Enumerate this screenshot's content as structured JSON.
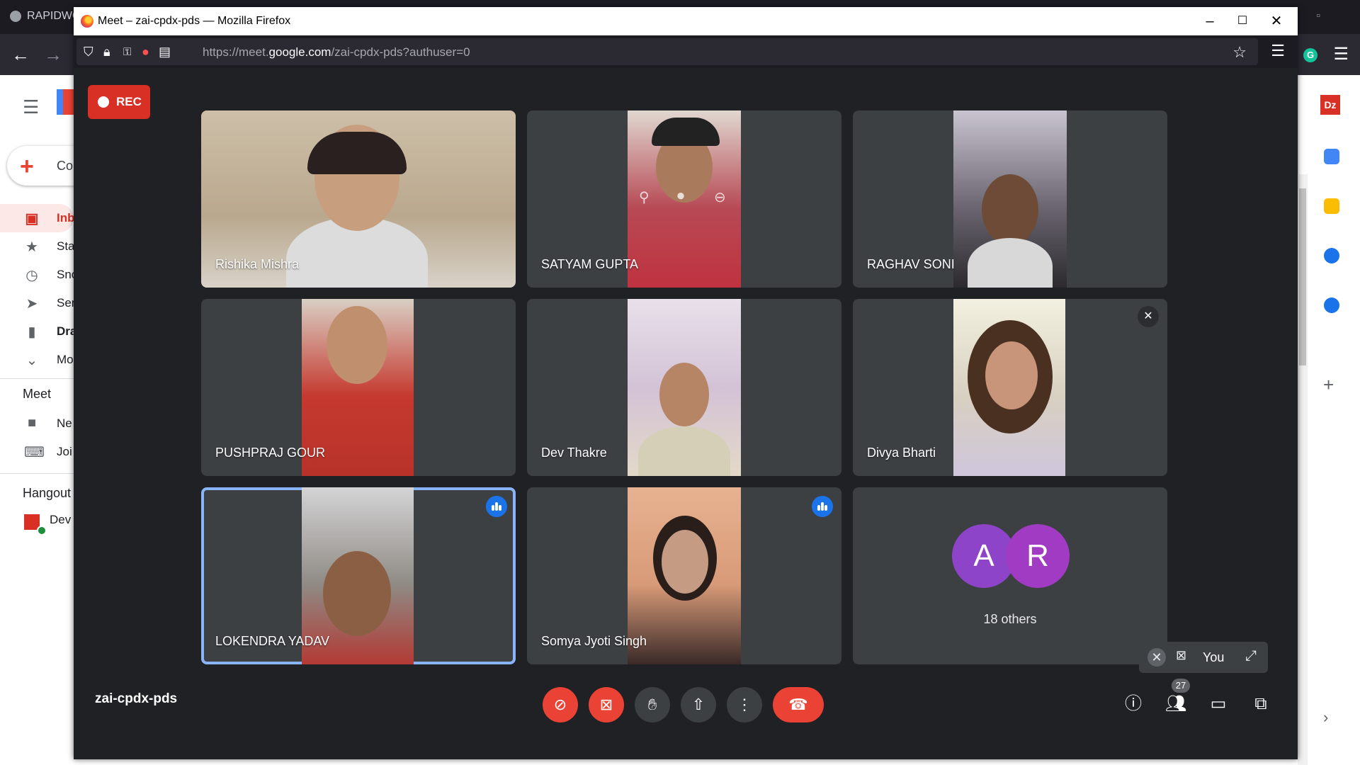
{
  "background_window": {
    "title": "RAPIDWO",
    "compose_label": "Co",
    "sidebar": [
      {
        "label": "Inb",
        "icon": "inbox-icon"
      },
      {
        "label": "Sta",
        "icon": "star-icon"
      },
      {
        "label": "Sno",
        "icon": "clock-icon"
      },
      {
        "label": "Sen",
        "icon": "send-icon"
      },
      {
        "label": "Dra",
        "icon": "draft-icon"
      },
      {
        "label": "Mo",
        "icon": "chevron-down-icon"
      }
    ],
    "meet_section": "Meet",
    "meet_items": [
      {
        "label": "Ne",
        "icon": "video-camera-icon"
      },
      {
        "label": "Joi",
        "icon": "keyboard-icon"
      }
    ],
    "hangouts_section": "Hangout",
    "hangouts_contact": "Dev"
  },
  "browser": {
    "window_title": "Meet – zai-cpdx-pds — Mozilla Firefox",
    "url_prefix": "https://meet.",
    "url_host": "google.com",
    "url_path": "/zai-cpdx-pds?authuser=0"
  },
  "meet": {
    "rec_label": "REC",
    "participants": [
      {
        "name": "Rishika Mishra"
      },
      {
        "name": "SATYAM GUPTA"
      },
      {
        "name": "RAGHAV SONI"
      },
      {
        "name": "PUSHPRAJ GOUR"
      },
      {
        "name": "Dev Thakre"
      },
      {
        "name": "Divya Bharti",
        "muted": true
      },
      {
        "name": "LOKENDRA YADAV",
        "speaking": true,
        "active": true
      },
      {
        "name": "Somya Jyoti Singh",
        "speaking": true
      }
    ],
    "others": {
      "avatars": [
        {
          "letter": "A",
          "color": "#8e44c9"
        },
        {
          "letter": "R",
          "color": "#a13bc4"
        }
      ],
      "label": "18 others"
    },
    "self_view_label": "You",
    "meeting_code": "zai-cpdx-pds",
    "participant_count": "27",
    "colors": {
      "background": "#202124",
      "tile": "#3c4043",
      "danger": "#ea4335",
      "rec": "#d93025",
      "active_border": "#8ab4f8",
      "speaking": "#1a73e8"
    }
  }
}
